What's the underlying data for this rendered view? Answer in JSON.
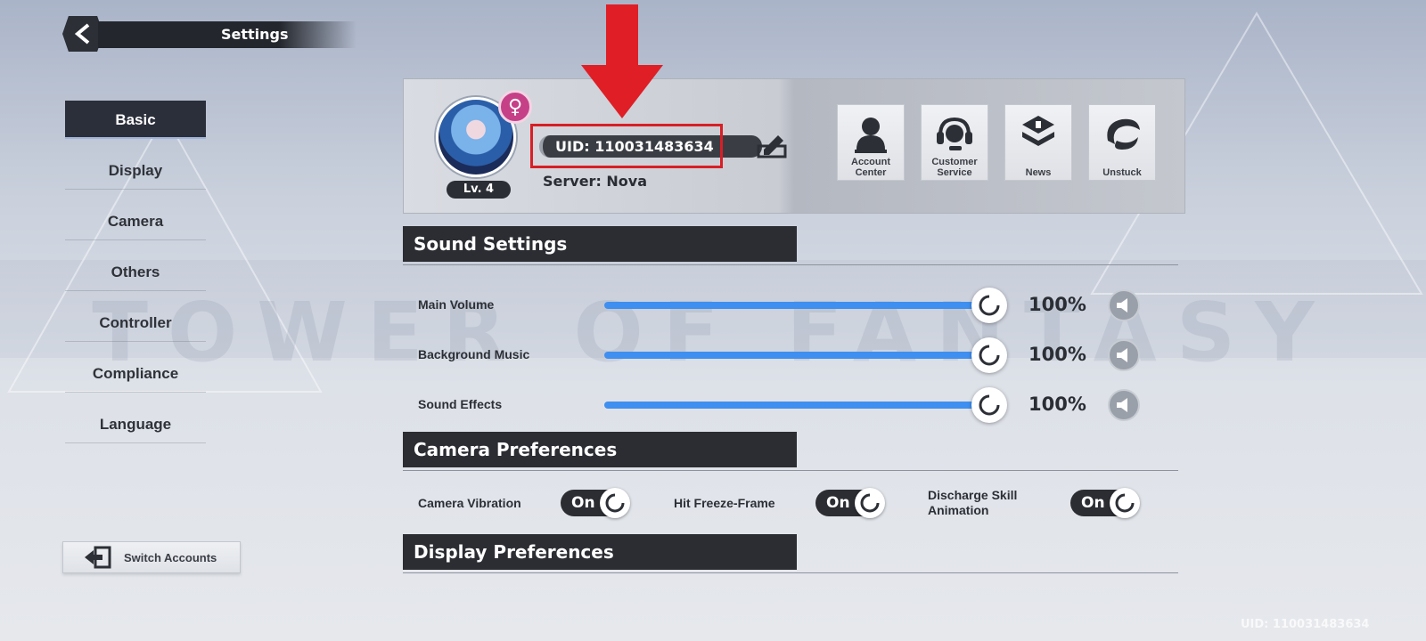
{
  "header": {
    "title": "Settings"
  },
  "watermark": "TOWER OF FANTASY",
  "sidebar": {
    "items": [
      {
        "label": "Basic",
        "active": true
      },
      {
        "label": "Display"
      },
      {
        "label": "Camera"
      },
      {
        "label": "Others"
      },
      {
        "label": "Controller"
      },
      {
        "label": "Compliance"
      },
      {
        "label": "Language"
      }
    ],
    "switch_accounts": "Switch Accounts"
  },
  "profile": {
    "level": "Lv. 4",
    "uid": "UID: 110031483634",
    "server": "Server: Nova",
    "gender_icon": "female-icon",
    "quick_buttons": [
      {
        "label_line1": "Account",
        "label_line2": "Center",
        "icon": "account-icon"
      },
      {
        "label_line1": "Customer",
        "label_line2": "Service",
        "icon": "headset-icon"
      },
      {
        "label_line1": "",
        "label_line2": "News",
        "icon": "news-icon"
      },
      {
        "label_line1": "",
        "label_line2": "Unstuck",
        "icon": "unstuck-icon"
      }
    ]
  },
  "sound": {
    "title": "Sound Settings",
    "rows": [
      {
        "label": "Main Volume",
        "value": 1.0,
        "display": "100%"
      },
      {
        "label": "Background Music",
        "value": 1.0,
        "display": "100%"
      },
      {
        "label": "Sound Effects",
        "value": 1.0,
        "display": "100%"
      }
    ]
  },
  "camera": {
    "title": "Camera Preferences",
    "toggles": [
      {
        "label": "Camera Vibration",
        "state": "On"
      },
      {
        "label": "Hit Freeze-Frame",
        "state": "On"
      },
      {
        "label_line1": "Discharge Skill",
        "label_line2": "Animation",
        "state": "On"
      }
    ]
  },
  "display": {
    "title": "Display Preferences"
  },
  "footer": {
    "uid": "UID: 110031483634"
  },
  "colors": {
    "accent": "#3f8ff0",
    "highlight": "#d81f26",
    "panel_dark": "#2b2d32"
  }
}
